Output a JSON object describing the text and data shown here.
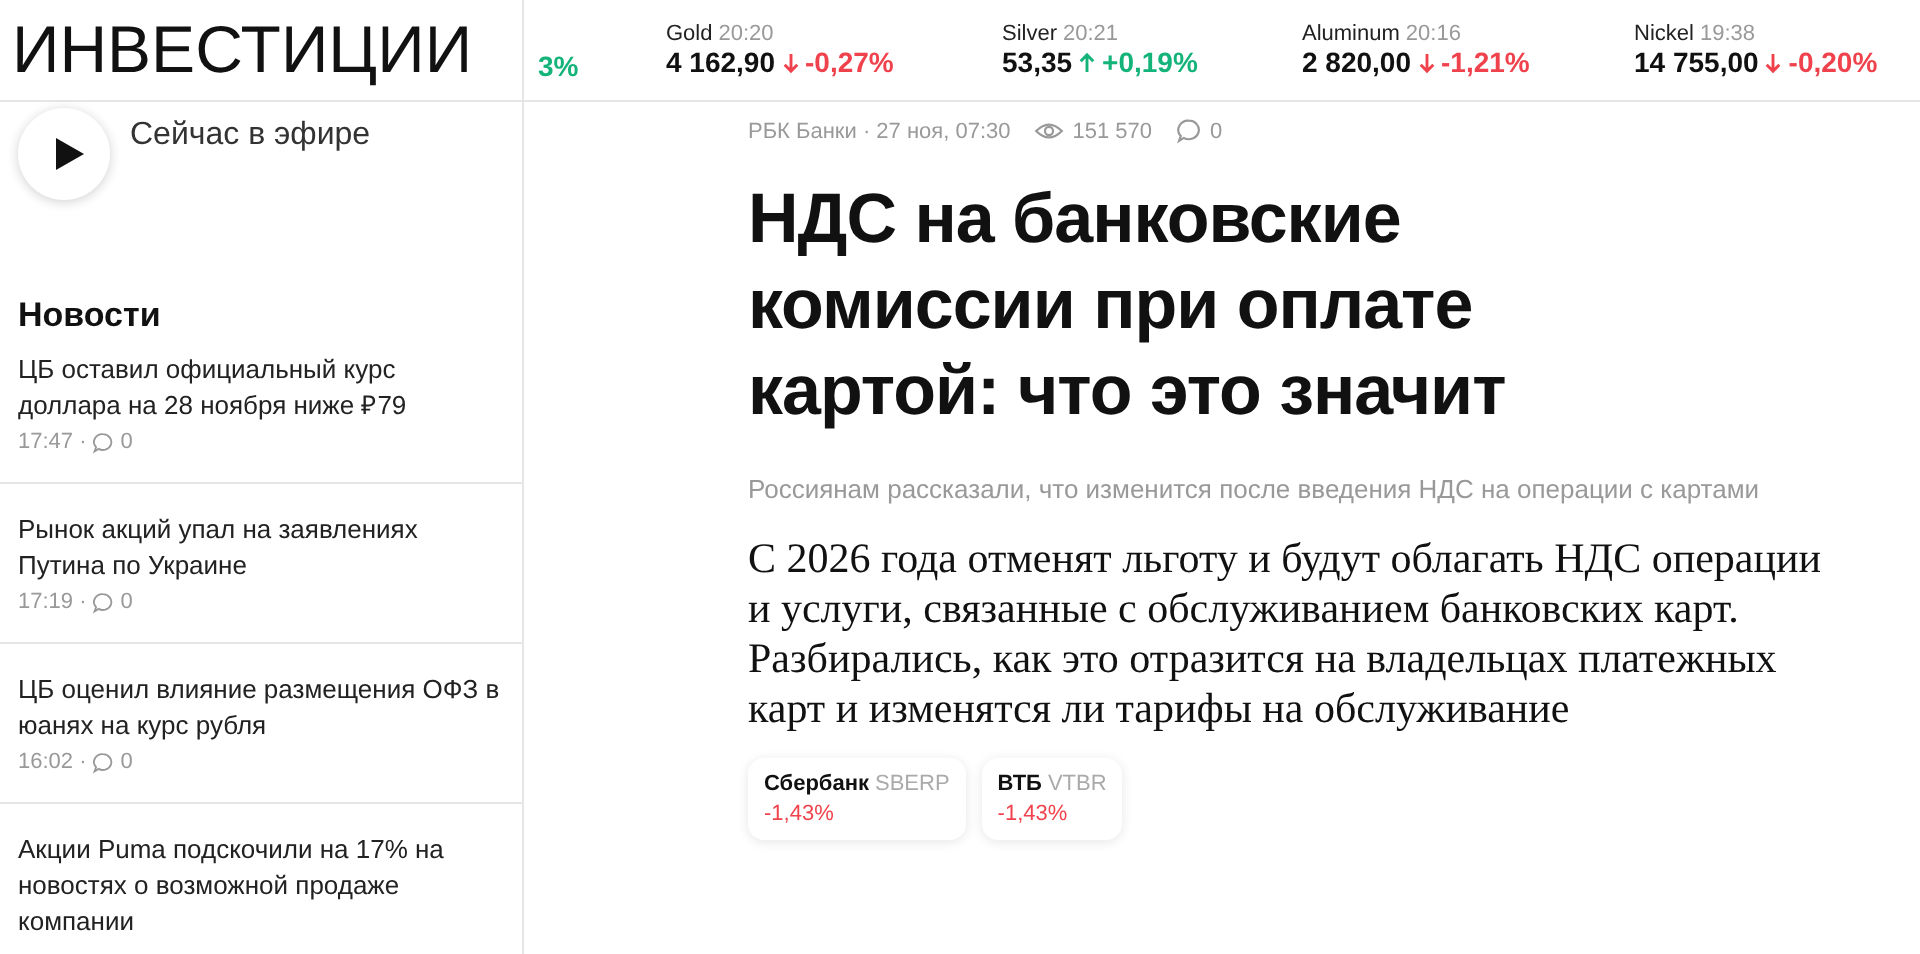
{
  "header": {
    "logo": "ИНВЕСТИЦИИ",
    "tickers": [
      {
        "change": "3%",
        "kind": "up"
      },
      {
        "name": "Gold",
        "time": "20:20",
        "value": "4 162,90",
        "change": "-0,27%",
        "kind": "down"
      },
      {
        "name": "Silver",
        "time": "20:21",
        "value": "53,35",
        "change": "+0,19%",
        "kind": "up"
      },
      {
        "name": "Aluminum",
        "time": "20:16",
        "value": "2 820,00",
        "change": "-1,21%",
        "kind": "down"
      },
      {
        "name": "Nickel",
        "time": "19:38",
        "value": "14 755,00",
        "change": "-0,20%",
        "kind": "down"
      }
    ]
  },
  "sidebar": {
    "live": "Сейчас в эфире",
    "news_title": "Новости",
    "news": [
      {
        "title": "ЦБ оставил официальный курс доллара на 28 ноября ниже ₽79",
        "time": "17:47 ·",
        "comments": "0"
      },
      {
        "title": "Рынок акций упал на заявлениях Путина по Украине",
        "time": "17:19 ·",
        "comments": "0"
      },
      {
        "title": "ЦБ оценил влияние размещения ОФЗ в юанях на курс рубля",
        "time": "16:02 ·",
        "comments": "0"
      },
      {
        "title": "Акции Puma подскочили на 17% на новостях о возможной продаже компании"
      }
    ]
  },
  "article": {
    "byline": "РБК Банки · 27 ноя, 07:30",
    "views": "151 570",
    "comments": "0",
    "title": "НДС на банковские комиссии при оплате картой: что это значит",
    "subtitle": "Россиянам рассказали, что изменится после введения НДС на операции с картами",
    "lead": "С 2026 года отменят льготу и будут облагать НДС операции и услуги, связанные с обслуживанием банковских карт. Разбирались, как это отразится на владельцах платежных карт и изменятся ли тарифы на обслуживание",
    "stocks": [
      {
        "name": "Сбербанк",
        "ticker": "SBERP",
        "change": "-1,43%",
        "kind": "down"
      },
      {
        "name": "ВТБ",
        "ticker": "VTBR",
        "change": "-1,43%",
        "kind": "down"
      }
    ]
  }
}
